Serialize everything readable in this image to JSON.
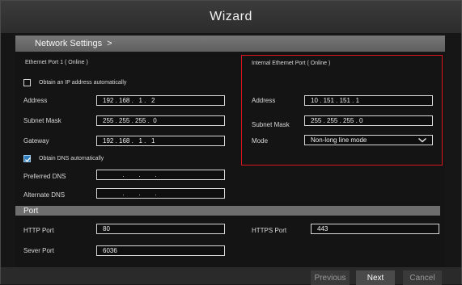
{
  "window": {
    "title": "Wizard"
  },
  "breadcrumb": {
    "label": "Network Settings",
    "arrow": ">"
  },
  "ethernet1": {
    "header": "Ethernet Port 1 ( Online )",
    "obtain_ip_label": "Obtain an IP address automatically",
    "obtain_ip_checked": false,
    "address_label": "Address",
    "address_value": "192 . 168 .   1 .   2",
    "subnet_label": "Subnet Mask",
    "subnet_value": "255 . 255 . 255 .  0",
    "gateway_label": "Gateway",
    "gateway_value": "192 . 168 .   1 .   1",
    "obtain_dns_label": "Obtain DNS automatically",
    "obtain_dns_checked": true,
    "preferred_dns_label": "Preferred DNS",
    "preferred_dns_value": "           .        .        .",
    "alternate_dns_label": "Alternate DNS",
    "alternate_dns_value": "           .        .        ."
  },
  "internal": {
    "header": "Internal Ethernet Port ( Online )",
    "address_label": "Address",
    "address_value": "10 . 151 . 151 . 1",
    "subnet_label": "Subnet Mask",
    "subnet_value": "255 . 255 . 255 . 0",
    "mode_label": "Mode",
    "mode_value": "Non-long line mode",
    "highlight_color": "#d8141c"
  },
  "port": {
    "header": "Port",
    "http_label": "HTTP Port",
    "http_value": "80",
    "https_label": "HTTPS Port",
    "https_value": "443",
    "server_label": "Sever Port",
    "server_value": "6036"
  },
  "footer": {
    "previous_label": "Previous",
    "next_label": "Next",
    "cancel_label": "Cancel"
  },
  "icons": {
    "checkbox_check": "check-icon",
    "dropdown": "chevron-down-icon"
  }
}
